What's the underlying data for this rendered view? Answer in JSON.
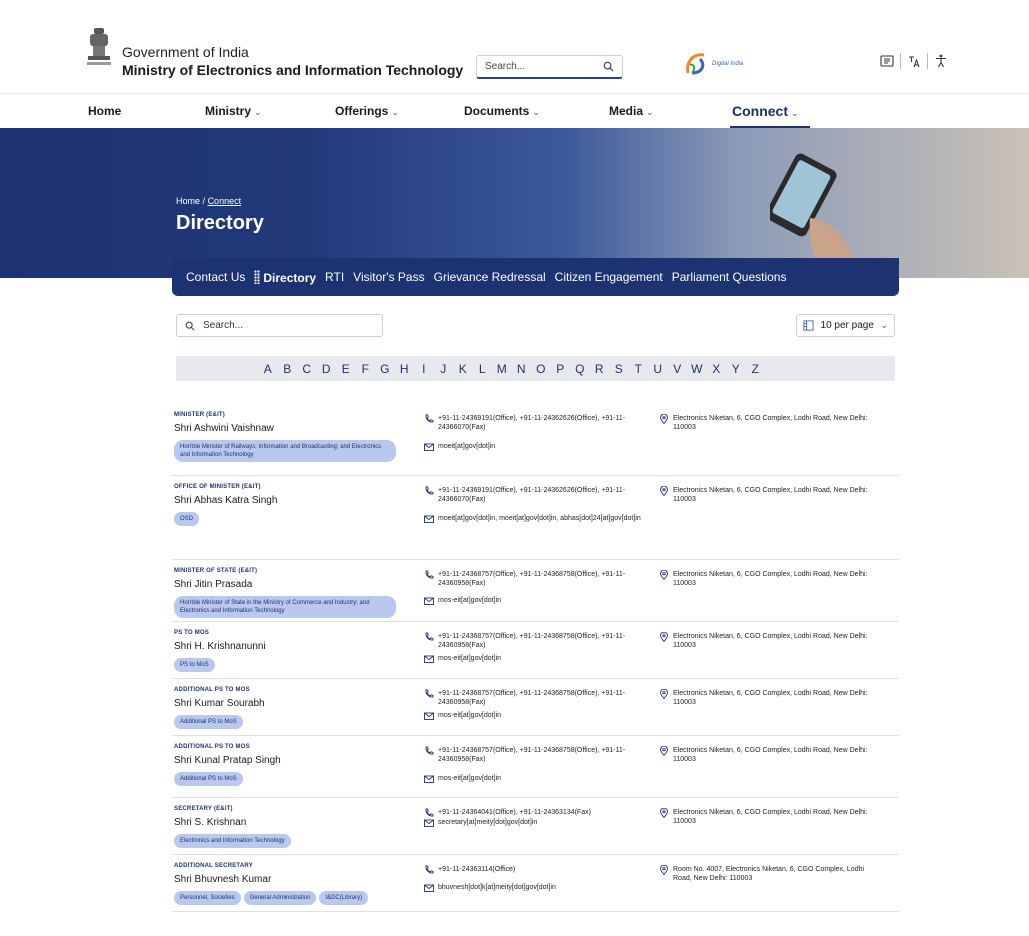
{
  "header": {
    "gov_title": "Government of India",
    "ministry_title": "Ministry of Electronics and Information Technology",
    "search_placeholder": "Search...",
    "digital_india_text": "Digital India"
  },
  "nav": {
    "items": [
      {
        "label": "Home",
        "has_dropdown": false
      },
      {
        "label": "Ministry",
        "has_dropdown": true
      },
      {
        "label": "Offerings",
        "has_dropdown": true
      },
      {
        "label": "Documents",
        "has_dropdown": true
      },
      {
        "label": "Media",
        "has_dropdown": true
      },
      {
        "label": "Connect",
        "has_dropdown": true,
        "active": true
      }
    ],
    "chevron": "⌄"
  },
  "banner": {
    "breadcrumb_home": "Home",
    "breadcrumb_sep": "/",
    "breadcrumb_current": "Connect",
    "title": "Directory"
  },
  "subtabs": [
    {
      "label": "Contact Us"
    },
    {
      "label": "Directory",
      "active": true
    },
    {
      "label": "RTI"
    },
    {
      "label": "Visitor's Pass"
    },
    {
      "label": "Grievance Redressal"
    },
    {
      "label": "Citizen Engagement"
    },
    {
      "label": "Parliament Questions"
    }
  ],
  "directory": {
    "search_placeholder": "Search...",
    "per_page": "10 per page",
    "alphabet": [
      "A",
      "B",
      "C",
      "D",
      "E",
      "F",
      "G",
      "H",
      "I",
      "J",
      "K",
      "L",
      "M",
      "N",
      "O",
      "P",
      "Q",
      "R",
      "S",
      "T",
      "U",
      "V",
      "W",
      "X",
      "Y",
      "Z"
    ],
    "entries": [
      {
        "designation": "MINISTER (E&IT)",
        "name": "Shri Ashwini Vaishnaw",
        "tags": [
          "Hon'ble Minister of Railways; Information and Broadcasting; and Electronics and Information Technology"
        ],
        "phone": "+91-11-24369191(Office), +91-11-24362626(Office), +91-11-24366070(Fax)",
        "email": "moeit[at]gov[dot]in",
        "address": "Electronics Niketan, 6, CGO Complex, Lodhi Road, New Delhi: 110003"
      },
      {
        "designation": "OFFICE OF MINISTER (E&IT)",
        "name": "Shri Abhas Katra Singh",
        "tags": [
          "OSD"
        ],
        "phone": "+91-11-24369191(Office), +91-11-24362626(Office), +91-11-24366070(Fax)",
        "email": "moeit[at]gov[dot]in, moeit[at]gov[dot]in, abhas[dot]24[at]gov[dot]in",
        "address": "Electronics Niketan, 6, CGO Complex, Lodhi Road, New Delhi: 110003"
      },
      {
        "designation": "MINISTER OF STATE (E&IT)",
        "name": "Shri Jitin Prasada",
        "tags": [
          "Hon'ble Minister of State in the Ministry of Commerce and Industry; and Electronics and Information Technology"
        ],
        "phone": "+91-11-24368757(Office), +91-11-24368758(Office), +91-11-24360958(Fax)",
        "email": "mos-eit[at]gov[dot]in",
        "address": "Electronics Niketan, 6, CGO Complex, Lodhi Road, New Delhi: 110003"
      },
      {
        "designation": "PS TO MOS",
        "name": "Shri H. Krishnanunni",
        "tags": [
          "PS to MoS"
        ],
        "phone": "+91-11-24368757(Office), +91-11-24368758(Office), +91-11-24360958(Fax)",
        "email": "mos-eit[at]gov[dot]in",
        "address": "Electronics Niketan, 6, CGO Complex, Lodhi Road, New Delhi: 110003"
      },
      {
        "designation": "ADDITIONAL PS TO MOS",
        "name": "Shri Kumar Sourabh",
        "tags": [
          "Additional PS to MoS"
        ],
        "phone": "+91-11-24368757(Office), +91-11-24368758(Office), +91-11-24360958(Fax)",
        "email": "mos-eit[at]gov[dot]in",
        "address": "Electronics Niketan, 6, CGO Complex, Lodhi Road, New Delhi: 110003"
      },
      {
        "designation": "ADDITIONAL PS TO MOS",
        "name": "Shri Kunal Pratap Singh",
        "tags": [
          "Additional PS to MoS"
        ],
        "phone": "+91-11-24368757(Office), +91-11-24368758(Office), +91-11-24360958(Fax)",
        "email": "mos-eit[at]gov[dot]in",
        "address": "Electronics Niketan, 6, CGO Complex, Lodhi Road, New Delhi: 110003"
      },
      {
        "designation": "SECRETARY (E&IT)",
        "name": "Shri S. Krishnan",
        "tags": [
          "Electronics and Information Technology"
        ],
        "phone": "+91-11-24364041(Office), +91-11-24363134(Fax)",
        "email": "secretary[at]meity[dot]gov[dot]in",
        "address": "Electronics Niketan, 6, CGO Complex, Lodhi Road, New Delhi: 110003"
      },
      {
        "designation": "ADDITIONAL SECRETARY",
        "name": "Shri Bhuvnesh Kumar",
        "tags": [
          "Personnel, Societies",
          "General Administration",
          "I&DC(Library)"
        ],
        "phone": "+91-11-24363114(Office)",
        "email": "bhuvnesh[dot]k[at]meity[dot]gov[dot]in",
        "address": "Room No. 4007, Electronics Niketan, 6, CGO Complex, Lodhi Road, New Delhi: 110003"
      }
    ]
  },
  "colors": {
    "navy": "#1d3272",
    "tag_bg": "#b9c8ee",
    "alpha_bg": "#e8e9ec"
  }
}
